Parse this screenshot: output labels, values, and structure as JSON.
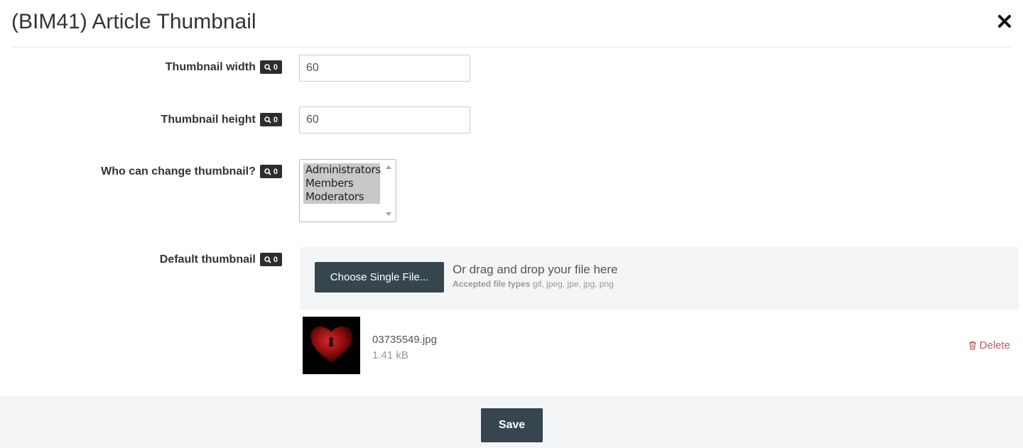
{
  "modal": {
    "title": "(BIM41) Article Thumbnail",
    "close_icon": "close-icon"
  },
  "fields": {
    "width": {
      "label": "Thumbnail width",
      "badge": "0",
      "value": "60"
    },
    "height": {
      "label": "Thumbnail height",
      "badge": "0",
      "value": "60"
    },
    "who_can_change": {
      "label": "Who can change thumbnail?",
      "badge": "0",
      "options": [
        "Administrators",
        "Members",
        "Moderators"
      ]
    },
    "default_thumbnail": {
      "label": "Default thumbnail",
      "badge": "0"
    }
  },
  "upload": {
    "choose_label": "Choose Single File...",
    "drop_text": "Or drag and drop your file here",
    "accepted_label": "Accepted file types",
    "accepted_types": "gif, jpeg, jpe, jpg, png"
  },
  "file": {
    "name": "03735549.jpg",
    "size": "1.41 kB",
    "delete_label": "Delete"
  },
  "footer": {
    "save_label": "Save"
  },
  "colors": {
    "button_bg": "#37454f",
    "badge_bg": "#2e2e2e",
    "delete": "#b85c5c",
    "panel_bg": "#f4f5f6"
  }
}
